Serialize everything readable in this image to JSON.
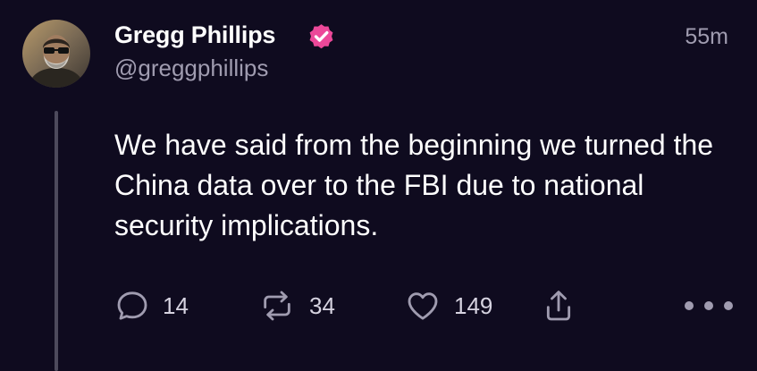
{
  "post": {
    "author": {
      "display_name": "Gregg Phillips",
      "handle": "@greggphillips",
      "verified": true,
      "avatar": "bearded-man-sunglasses-photo"
    },
    "timestamp": "55m",
    "text": "We have said from the beginning we turned the China data over to the FBI due to national security implications.",
    "actions": {
      "reply": {
        "icon": "reply-icon",
        "count": "14"
      },
      "repost": {
        "icon": "repost-icon",
        "count": "34"
      },
      "like": {
        "icon": "heart-icon",
        "count": "149"
      },
      "share": {
        "icon": "share-icon"
      },
      "more": {
        "icon": "more-horizontal-icon"
      }
    }
  },
  "colors": {
    "background": "#0f0b1f",
    "text_primary": "#ffffff",
    "text_secondary": "#a09cb0",
    "verified_badge": "#ec4899",
    "thread_line": "#4d4a5c"
  }
}
